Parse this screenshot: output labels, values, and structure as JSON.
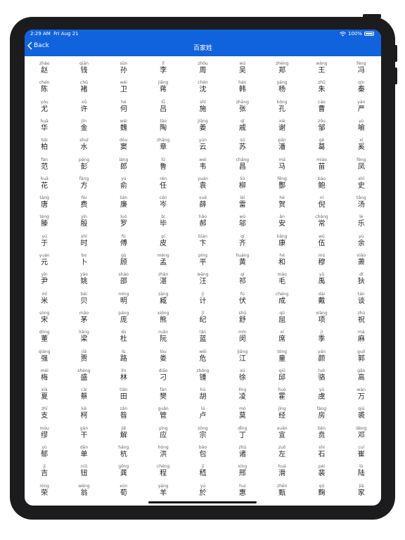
{
  "status_bar": {
    "time": "2:29 AM",
    "date": "Fri Aug 21",
    "battery": "100%"
  },
  "nav": {
    "back_label": "Back",
    "title": "百家姓"
  },
  "colors": {
    "header": "#1162dd"
  },
  "surnames": [
    [
      "zhào",
      "赵"
    ],
    [
      "qián",
      "钱"
    ],
    [
      "sūn",
      "孙"
    ],
    [
      "lǐ",
      "李"
    ],
    [
      "zhōu",
      "周"
    ],
    [
      "wú",
      "吴"
    ],
    [
      "zhèng",
      "郑"
    ],
    [
      "wáng",
      "王"
    ],
    [
      "féng",
      "冯"
    ],
    [
      "chén",
      "陈"
    ],
    [
      "chǔ",
      "褚"
    ],
    [
      "wèi",
      "卫"
    ],
    [
      "jiǎng",
      "蒋"
    ],
    [
      "chén",
      "沈"
    ],
    [
      "hán",
      "韩"
    ],
    [
      "yáng",
      "杨"
    ],
    [
      "zhū",
      "朱"
    ],
    [
      "qín",
      "秦"
    ],
    [
      "yóu",
      "尤"
    ],
    [
      "xǔ",
      "许"
    ],
    [
      "hé",
      "何"
    ],
    [
      "lǚ",
      "吕"
    ],
    [
      "shī",
      "施"
    ],
    [
      "zhāng",
      "张"
    ],
    [
      "kǒng",
      "孔"
    ],
    [
      "cáo",
      "曹"
    ],
    [
      "yán",
      "严"
    ],
    [
      "huà",
      "华"
    ],
    [
      "jīn",
      "金"
    ],
    [
      "wèi",
      "魏"
    ],
    [
      "táo",
      "陶"
    ],
    [
      "jiāng",
      "姜"
    ],
    [
      "qī",
      "戚"
    ],
    [
      "xiè",
      "谢"
    ],
    [
      "zōu",
      "邹"
    ],
    [
      "yù",
      "喻"
    ],
    [
      "bǎi",
      "柏"
    ],
    [
      "shuǐ",
      "水"
    ],
    [
      "dòu",
      "窦"
    ],
    [
      "zhāng",
      "章"
    ],
    [
      "yún",
      "云"
    ],
    [
      "sū",
      "苏"
    ],
    [
      "pān",
      "潘"
    ],
    [
      "gě",
      "葛"
    ],
    [
      "xī",
      "奚"
    ],
    [
      "fàn",
      "范"
    ],
    [
      "péng",
      "彭"
    ],
    [
      "láng",
      "郎"
    ],
    [
      "lǔ",
      "鲁"
    ],
    [
      "wéi",
      "韦"
    ],
    [
      "chāng",
      "昌"
    ],
    [
      "mǎ",
      "马"
    ],
    [
      "miáo",
      "苗"
    ],
    [
      "fèng",
      "凤"
    ],
    [
      "huā",
      "花"
    ],
    [
      "fāng",
      "方"
    ],
    [
      "yú",
      "俞"
    ],
    [
      "rèn",
      "任"
    ],
    [
      "yuán",
      "袁"
    ],
    [
      "liǔ",
      "柳"
    ],
    [
      "fēng",
      "酆"
    ],
    [
      "bào",
      "鲍"
    ],
    [
      "shǐ",
      "史"
    ],
    [
      "táng",
      "唐"
    ],
    [
      "fèi",
      "费"
    ],
    [
      "lián",
      "廉"
    ],
    [
      "cén",
      "岑"
    ],
    [
      "xuē",
      "薛"
    ],
    [
      "léi",
      "雷"
    ],
    [
      "hè",
      "贺"
    ],
    [
      "ní",
      "倪"
    ],
    [
      "tāng",
      "汤"
    ],
    [
      "téng",
      "滕"
    ],
    [
      "yīn",
      "殷"
    ],
    [
      "luó",
      "罗"
    ],
    [
      "bì",
      "毕"
    ],
    [
      "hǎo",
      "郝"
    ],
    [
      "wū",
      "邬"
    ],
    [
      "ān",
      "安"
    ],
    [
      "cháng",
      "常"
    ],
    [
      "lè",
      "乐"
    ],
    [
      "yú",
      "于"
    ],
    [
      "shí",
      "时"
    ],
    [
      "fù",
      "傅"
    ],
    [
      "pí",
      "皮"
    ],
    [
      "biàn",
      "卞"
    ],
    [
      "qí",
      "齐"
    ],
    [
      "kāng",
      "康"
    ],
    [
      "wǔ",
      "伍"
    ],
    [
      "yú",
      "余"
    ],
    [
      "yuán",
      "元"
    ],
    [
      "bo",
      "卜"
    ],
    [
      "gù",
      "顾"
    ],
    [
      "mèng",
      "孟"
    ],
    [
      "píng",
      "平"
    ],
    [
      "huáng",
      "黄"
    ],
    [
      "hé",
      "和"
    ],
    [
      "mù",
      "穆"
    ],
    [
      "xiāo",
      "萧"
    ],
    [
      "yǐn",
      "尹"
    ],
    [
      "yáo",
      "姚"
    ],
    [
      "shào",
      "邵"
    ],
    [
      "zhàn",
      "湛"
    ],
    [
      "wāng",
      "汪"
    ],
    [
      "qí",
      "祁"
    ],
    [
      "máo",
      "毛"
    ],
    [
      "yǔ",
      "禹"
    ],
    [
      "dí",
      "狄"
    ],
    [
      "mǐ",
      "米"
    ],
    [
      "bèi",
      "贝"
    ],
    [
      "míng",
      "明"
    ],
    [
      "zāng",
      "臧"
    ],
    [
      "jì",
      "计"
    ],
    [
      "fú",
      "伏"
    ],
    [
      "chéng",
      "成"
    ],
    [
      "dài",
      "戴"
    ],
    [
      "tán",
      "谈"
    ],
    [
      "sòng",
      "宋"
    ],
    [
      "máo",
      "茅"
    ],
    [
      "páng",
      "庞"
    ],
    [
      "xióng",
      "熊"
    ],
    [
      "jǐ",
      "纪"
    ],
    [
      "shū",
      "舒"
    ],
    [
      "qū",
      "屈"
    ],
    [
      "xiàng",
      "项"
    ],
    [
      "zhù",
      "祝"
    ],
    [
      "dǒng",
      "董"
    ],
    [
      "liáng",
      "梁"
    ],
    [
      "dù",
      "杜"
    ],
    [
      "ruǎn",
      "阮"
    ],
    [
      "lán",
      "蓝"
    ],
    [
      "mǐn",
      "闵"
    ],
    [
      "xí",
      "席"
    ],
    [
      "jì",
      "季"
    ],
    [
      "má",
      "麻"
    ],
    [
      "qiáng",
      "强"
    ],
    [
      "jiǎ",
      "贾"
    ],
    [
      "lù",
      "路"
    ],
    [
      "lóu",
      "娄"
    ],
    [
      "wēi",
      "危"
    ],
    [
      "jiāng",
      "江"
    ],
    [
      "tóng",
      "童"
    ],
    [
      "yán",
      "颜"
    ],
    [
      "guō",
      "郭"
    ],
    [
      "méi",
      "梅"
    ],
    [
      "shèng",
      "盛"
    ],
    [
      "lín",
      "林"
    ],
    [
      "diāo",
      "刁"
    ],
    [
      "zhōng",
      "锺"
    ],
    [
      "xú",
      "徐"
    ],
    [
      "qiū",
      "邱"
    ],
    [
      "luò",
      "骆"
    ],
    [
      "gāo",
      "高"
    ],
    [
      "xià",
      "夏"
    ],
    [
      "cài",
      "蔡"
    ],
    [
      "tián",
      "田"
    ],
    [
      "fán",
      "樊"
    ],
    [
      "hú",
      "胡"
    ],
    [
      "líng",
      "凌"
    ],
    [
      "huò",
      "霍"
    ],
    [
      "yú",
      "虞"
    ],
    [
      "wàn",
      "万"
    ],
    [
      "zhī",
      "支"
    ],
    [
      "kē",
      "柯"
    ],
    [
      "zǎn",
      "昝"
    ],
    [
      "guǎn",
      "管"
    ],
    [
      "lú",
      "卢"
    ],
    [
      "mò",
      "莫"
    ],
    [
      "jīng",
      "经"
    ],
    [
      "fáng",
      "房"
    ],
    [
      "qiú",
      "裘"
    ],
    [
      "móu",
      "缪"
    ],
    [
      "gān",
      "干"
    ],
    [
      "jiě",
      "解"
    ],
    [
      "yīng",
      "应"
    ],
    [
      "zōng",
      "宗"
    ],
    [
      "dīng",
      "丁"
    ],
    [
      "xuān",
      "宣"
    ],
    [
      "bēn",
      "贲"
    ],
    [
      "dèng",
      "邓"
    ],
    [
      "yù",
      "郁"
    ],
    [
      "dān",
      "单"
    ],
    [
      "háng",
      "杭"
    ],
    [
      "hóng",
      "洪"
    ],
    [
      "bāo",
      "包"
    ],
    [
      "zhū",
      "诸"
    ],
    [
      "zuǒ",
      "左"
    ],
    [
      "shí",
      "石"
    ],
    [
      "cuī",
      "崔"
    ],
    [
      "jí",
      "吉"
    ],
    [
      "niǔ",
      "钮"
    ],
    [
      "gōng",
      "龚"
    ],
    [
      "chéng",
      "程"
    ],
    [
      "jī",
      "嵇"
    ],
    [
      "xíng",
      "邢"
    ],
    [
      "huá",
      "滑"
    ],
    [
      "péi",
      "裴"
    ],
    [
      "lù",
      "陆"
    ],
    [
      "róng",
      "荣"
    ],
    [
      "wēng",
      "翁"
    ],
    [
      "xún",
      "荀"
    ],
    [
      "yáng",
      "羊"
    ],
    [
      "yú",
      "於"
    ],
    [
      "huì",
      "惠"
    ],
    [
      "zhēn",
      "甄"
    ],
    [
      "qū",
      "麴"
    ],
    [
      "jiā",
      "家"
    ]
  ]
}
